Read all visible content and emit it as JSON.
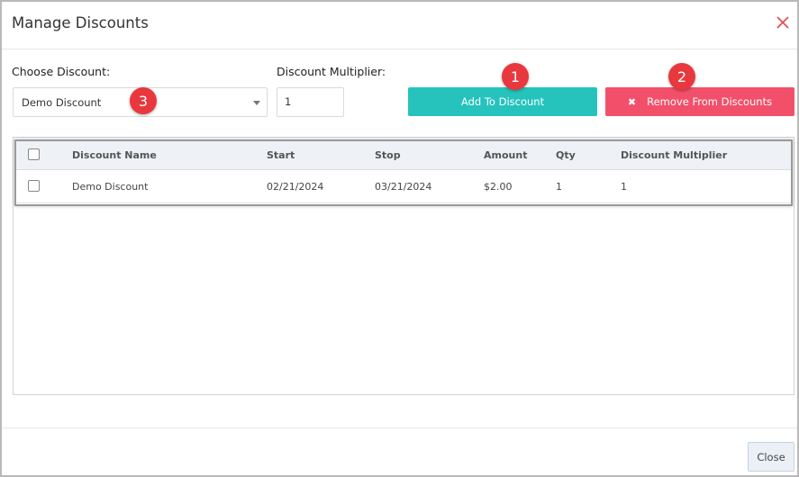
{
  "modal": {
    "title": "Manage Discounts"
  },
  "form": {
    "choose_discount_label": "Choose Discount:",
    "choose_discount_value": "Demo Discount",
    "multiplier_label": "Discount Multiplier:",
    "multiplier_value": "1",
    "add_button_label": "Add To Discount",
    "remove_button_label": "Remove From Discounts"
  },
  "badges": [
    "1",
    "2",
    "3"
  ],
  "table": {
    "columns": [
      "Discount Name",
      "Start",
      "Stop",
      "Amount",
      "Qty",
      "Discount Multiplier"
    ],
    "rows": [
      [
        "Demo Discount",
        "02/21/2024",
        "03/21/2024",
        "$2.00",
        "1",
        "1"
      ]
    ]
  },
  "footer": {
    "close_label": "Close"
  },
  "colors": {
    "add": "#26c3bd",
    "remove": "#f2506a",
    "badge": "#e8383d",
    "close_icon": "#e04b4b"
  },
  "icons": {
    "close": "close-icon",
    "remove": "times-icon",
    "dropdown": "chevron-down-icon"
  }
}
